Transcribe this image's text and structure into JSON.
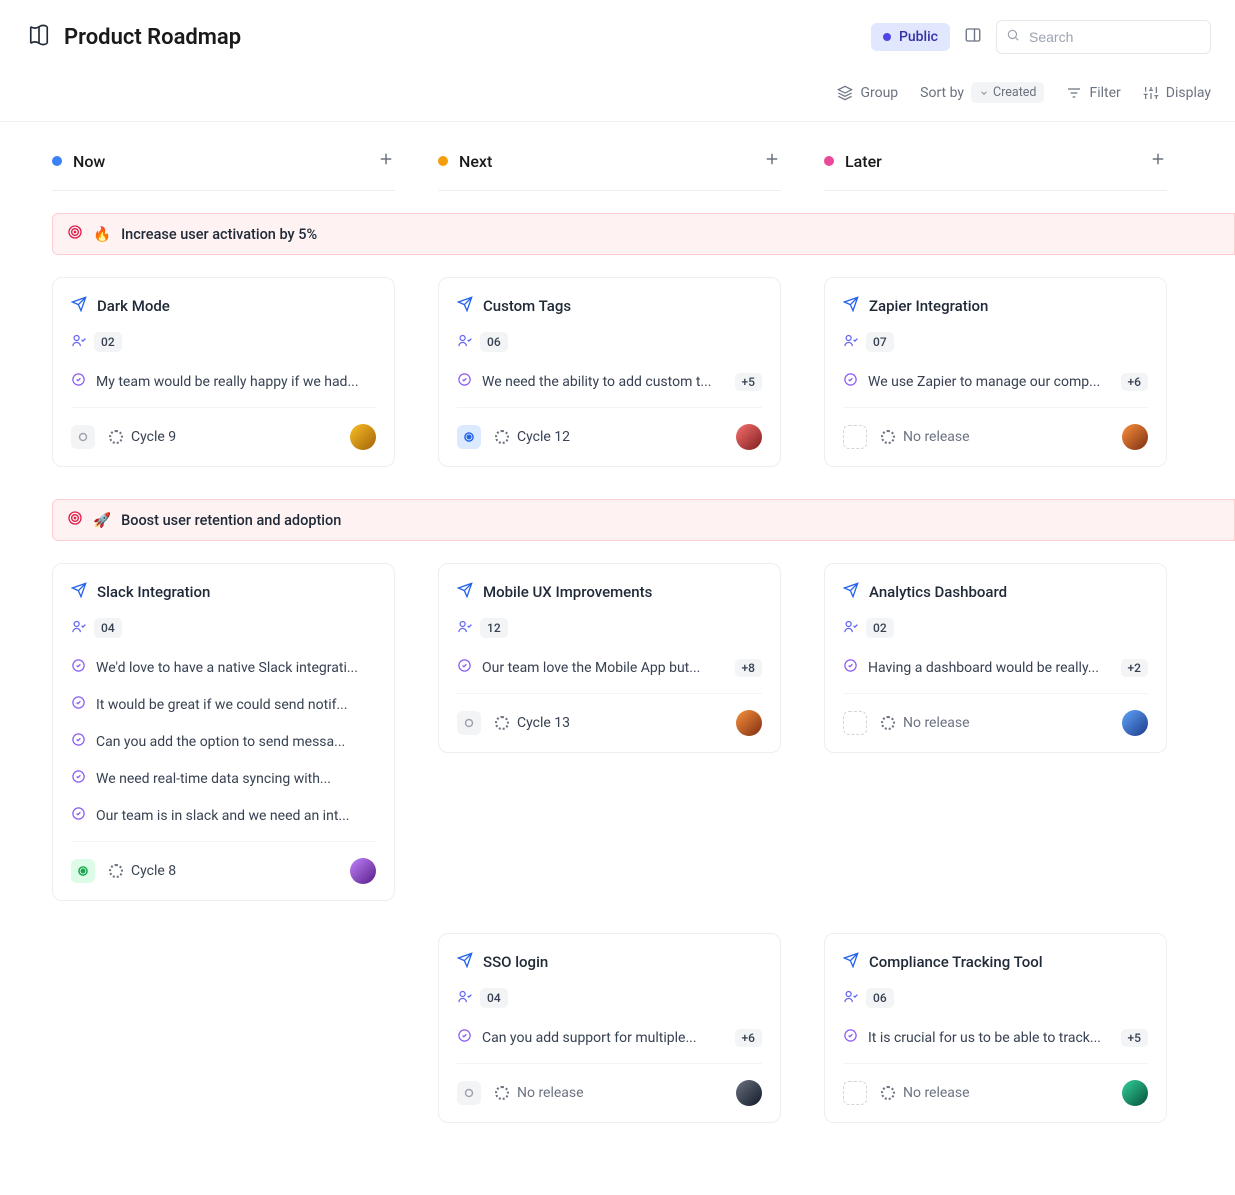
{
  "header": {
    "title": "Product Roadmap",
    "visibility_label": "Public",
    "search_placeholder": "Search"
  },
  "toolbar": {
    "group_label": "Group",
    "sortby_label": "Sort by",
    "sortby_value": "Created",
    "filter_label": "Filter",
    "display_label": "Display"
  },
  "columns": [
    {
      "name": "Now",
      "dot": "dot-blue"
    },
    {
      "name": "Next",
      "dot": "dot-orange"
    },
    {
      "name": "Later",
      "dot": "dot-pink"
    }
  ],
  "objectives": [
    {
      "emoji": "🔥",
      "title": "Increase user activation by 5%",
      "rows": [
        [
          {
            "title": "Dark Mode",
            "count": "02",
            "insights": [
              "My team would be really happy if we had..."
            ],
            "more": null,
            "status": "gray",
            "cycle": "Cycle 9",
            "avatar": "av1"
          },
          {
            "title": "Custom Tags",
            "count": "06",
            "insights": [
              "We need the ability to add custom t..."
            ],
            "more": "+5",
            "status": "blue",
            "cycle": "Cycle 12",
            "avatar": "av2"
          },
          {
            "title": "Zapier Integration",
            "count": "07",
            "insights": [
              "We use Zapier to manage our comp..."
            ],
            "more": "+6",
            "status": "dashed",
            "cycle": "No release",
            "avatar": "av3"
          }
        ]
      ]
    },
    {
      "emoji": "🚀",
      "title": "Boost user retention and adoption",
      "rows": [
        [
          {
            "title": "Slack Integration",
            "count": "04",
            "insights": [
              "We'd love to have a native Slack integrati...",
              "It would be great if we could send notif...",
              "Can you add the option to send messa...",
              "We need real-time data syncing with...",
              "Our team is in slack and we need an int..."
            ],
            "more": null,
            "status": "green",
            "cycle": "Cycle 8",
            "avatar": "av5"
          },
          {
            "title": "Mobile UX Improvements",
            "count": "12",
            "insights": [
              "Our team love the Mobile App but..."
            ],
            "more": "+8",
            "status": "gray",
            "cycle": "Cycle 13",
            "avatar": "av3"
          },
          {
            "title": "Analytics Dashboard",
            "count": "02",
            "insights": [
              "Having a dashboard would be really..."
            ],
            "more": "+2",
            "status": "dashed",
            "cycle": "No release",
            "avatar": "av4"
          }
        ],
        [
          null,
          {
            "title": "SSO login",
            "count": "04",
            "insights": [
              "Can you add support for multiple..."
            ],
            "more": "+6",
            "status": "gray",
            "cycle": "No release",
            "avatar": "av7"
          },
          {
            "title": "Compliance Tracking Tool",
            "count": "06",
            "insights": [
              "It is crucial for us to be able to track..."
            ],
            "more": "+5",
            "status": "dashed",
            "cycle": "No release",
            "avatar": "av6"
          }
        ]
      ]
    }
  ]
}
